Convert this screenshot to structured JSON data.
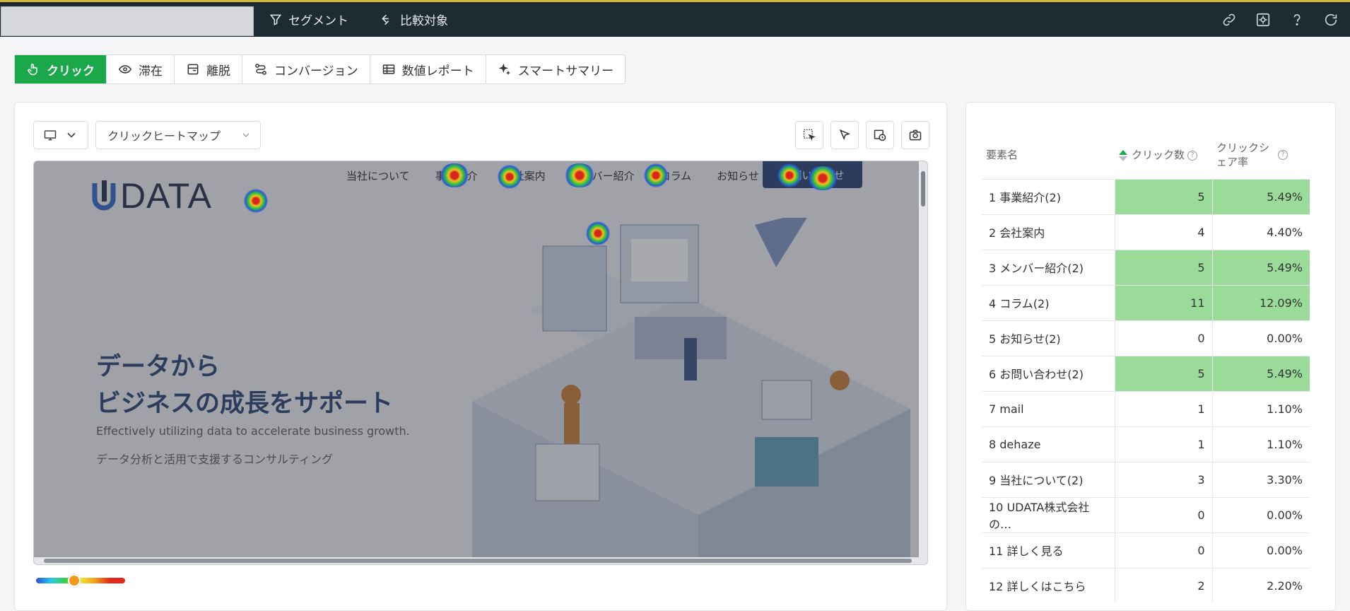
{
  "topbar": {
    "segment_label": "セグメント",
    "compare_label": "比較対象"
  },
  "tabs": [
    {
      "label": "クリック",
      "active": true
    },
    {
      "label": "滞在"
    },
    {
      "label": "離脱"
    },
    {
      "label": "コンバージョン"
    },
    {
      "label": "数値レポート"
    },
    {
      "label": "スマートサマリー"
    }
  ],
  "toolbar": {
    "heatmap_type": "クリックヒートマップ"
  },
  "site": {
    "logo_text": "DATA",
    "nav": [
      "当社について",
      "事業紹介",
      "会社案内",
      "メンバー紹介",
      "コラム",
      "お知らせ"
    ],
    "contact": "お問い合わせ",
    "hero_line1": "データから",
    "hero_line2": "ビジネスの成長をサポート",
    "hero_sub_en": "Effectively utilizing data to accelerate business growth.",
    "hero_sub_ja": "データ分析と活用で支援するコンサルティング"
  },
  "slider": {
    "level": 0.43
  },
  "table": {
    "headers": {
      "name": "要素名",
      "clicks": "クリック数",
      "share_line1": "クリックシ",
      "share_line2": "ェア率"
    },
    "rows": [
      {
        "name": "1 事業紹介(2)",
        "clicks": "5",
        "share": "5.49%",
        "hl": true
      },
      {
        "name": "2 会社案内",
        "clicks": "4",
        "share": "4.40%",
        "hl": false
      },
      {
        "name": "3 メンバー紹介(2)",
        "clicks": "5",
        "share": "5.49%",
        "hl": true
      },
      {
        "name": "4 コラム(2)",
        "clicks": "11",
        "share": "12.09%",
        "hl": true
      },
      {
        "name": "5 お知らせ(2)",
        "clicks": "0",
        "share": "0.00%",
        "hl": false
      },
      {
        "name": "6 お問い合わせ(2)",
        "clicks": "5",
        "share": "5.49%",
        "hl": true
      },
      {
        "name": "7 mail",
        "clicks": "1",
        "share": "1.10%",
        "hl": false
      },
      {
        "name": "8 dehaze",
        "clicks": "1",
        "share": "1.10%",
        "hl": false
      },
      {
        "name": "9 当社について(2)",
        "clicks": "3",
        "share": "3.30%",
        "hl": false
      },
      {
        "name": "10 UDATA株式会社の…",
        "clicks": "0",
        "share": "0.00%",
        "hl": false
      },
      {
        "name": "11 詳しく見る",
        "clicks": "0",
        "share": "0.00%",
        "hl": false
      },
      {
        "name": "12 詳しくはこちら",
        "clicks": "2",
        "share": "2.20%",
        "hl": false
      }
    ]
  }
}
